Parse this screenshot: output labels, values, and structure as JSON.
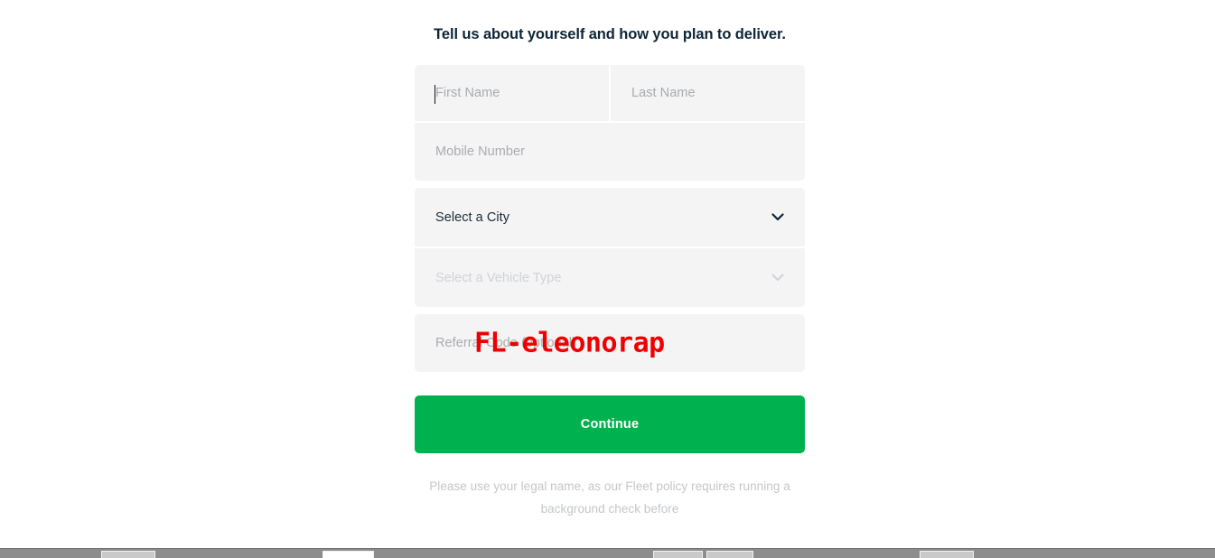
{
  "page": {
    "title": "Tell us about yourself and how you plan to deliver."
  },
  "form": {
    "first_name": {
      "placeholder": "First Name",
      "value": "",
      "focused": true
    },
    "last_name": {
      "placeholder": "Last Name",
      "value": ""
    },
    "mobile_number": {
      "placeholder": "Mobile Number",
      "value": ""
    },
    "city_select": {
      "label": "Select a City",
      "value": "",
      "enabled": true,
      "icon": "chevron-down-icon"
    },
    "vehicle_select": {
      "label": "Select a Vehicle Type",
      "value": "",
      "enabled": false,
      "icon": "chevron-down-icon"
    },
    "referral_code": {
      "placeholder": "Referral Code (optional)",
      "value": ""
    },
    "overlay_code": "FL-eleonorap",
    "submit_label": "Continue"
  },
  "legal": {
    "note": "Please use your legal name, as our Fleet policy requires running a background check before"
  },
  "colors": {
    "brand_green": "#00b14f",
    "title_navy": "#0e2538",
    "field_bg": "#f4f4f5",
    "placeholder_grey": "#a9abaf",
    "overlay_red": "#ee0000",
    "disabled_grey": "#d0d2d6"
  },
  "taskbar": {
    "present": true,
    "buttons": [
      "",
      "",
      "",
      "",
      ""
    ]
  }
}
